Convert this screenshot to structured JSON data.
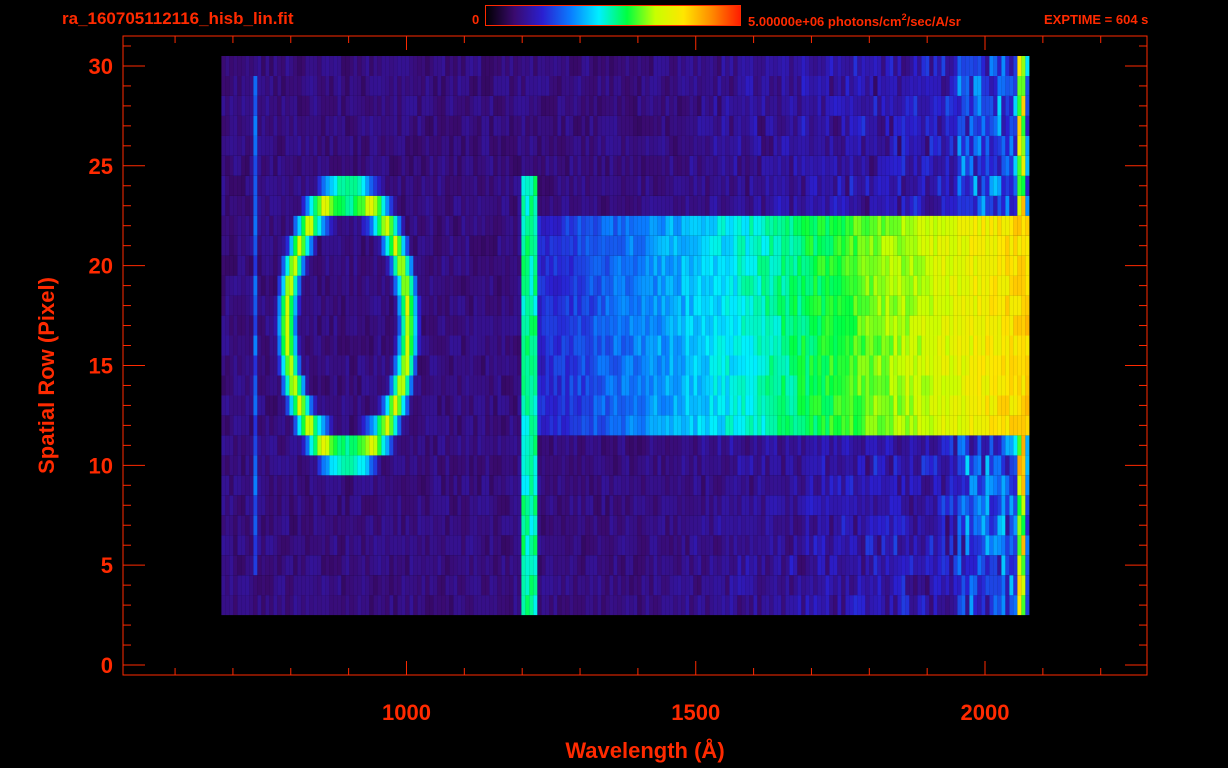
{
  "header": {
    "file_title": "ra_160705112116_hisb_lin.fit",
    "colorbar_min": "0",
    "colorbar_max_prefix": "5.00000e+06 photons/cm",
    "colorbar_max_sup": "2",
    "colorbar_max_suffix": "/sec/A/sr",
    "exptime": "EXPTIME = 604 s"
  },
  "colors": {
    "axis": "#ff2a00",
    "background": "#000000",
    "colormap": [
      "#000000",
      "#3a0a6e",
      "#2a1fd0",
      "#0a7cff",
      "#00f0ff",
      "#00ff40",
      "#c8ff00",
      "#ffe600",
      "#ff8a00",
      "#ff1e00"
    ]
  },
  "chart_data": {
    "type": "heatmap",
    "title": "ra_160705112116_hisb_lin.fit",
    "xlabel": "Wavelength (Å)",
    "ylabel": "Spatial Row (Pixel)",
    "xlim": [
      510,
      2280
    ],
    "ylim": [
      -0.5,
      31.5
    ],
    "x_ticks": [
      1000,
      1500,
      2000
    ],
    "x_tick_labels": [
      "1000",
      "1500",
      "2000"
    ],
    "y_ticks": [
      0,
      5,
      10,
      15,
      20,
      25,
      30
    ],
    "y_tick_labels": [
      "0",
      "5",
      "10",
      "15",
      "20",
      "25",
      "30"
    ],
    "colorbar": {
      "min": 0,
      "max": 5000000,
      "units": "photons/cm^2/sec/A/sr"
    },
    "exptime_s": 604,
    "spectral_extent": {
      "start": 680,
      "end": 2070
    },
    "features": [
      {
        "name": "elliptical ring",
        "x_center": 895,
        "y_center": 17,
        "x_half_width": 105,
        "y_half_height": 6.5,
        "peak_fraction": 0.7
      },
      {
        "name": "narrow vertical band",
        "x": 1210,
        "y_range": [
          3,
          24
        ],
        "peak_fraction": 0.55
      },
      {
        "name": "broad continuum",
        "x_range": [
          1200,
          2070
        ],
        "y_range": [
          12,
          22
        ],
        "peak_fraction": 0.8
      }
    ]
  }
}
